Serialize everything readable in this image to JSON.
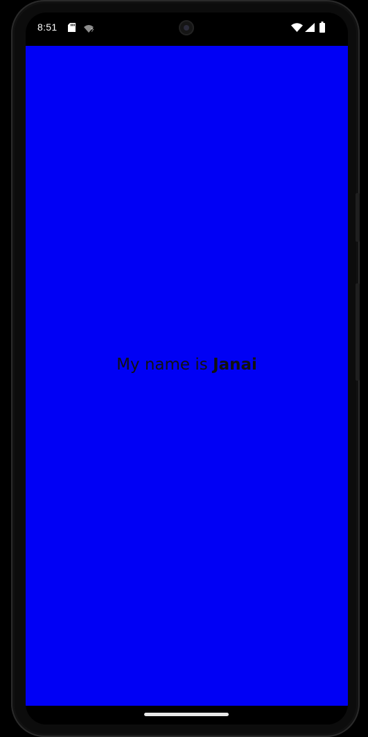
{
  "status_bar": {
    "time": "8:51",
    "icons": [
      "sd-card-icon",
      "wifi-question-icon",
      "wifi-icon",
      "signal-icon",
      "battery-icon"
    ]
  },
  "app": {
    "background_color": "#0000f5",
    "greeting_prefix": "My name is",
    "name": "Janai"
  }
}
